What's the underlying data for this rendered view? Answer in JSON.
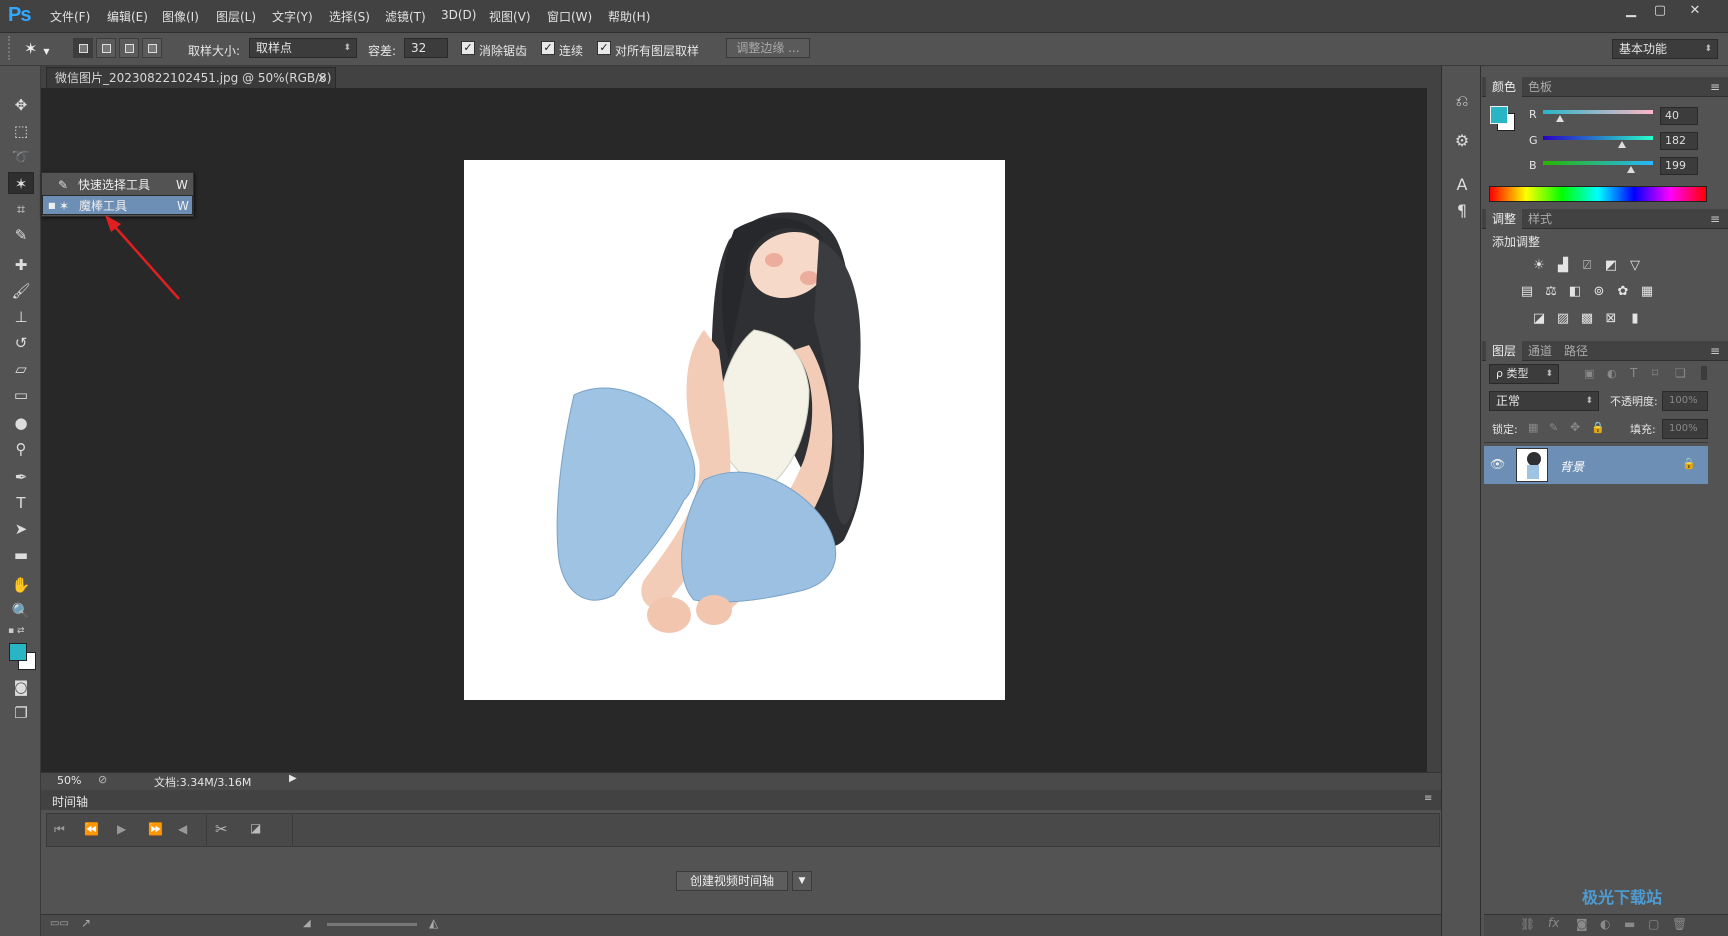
{
  "app": {
    "logo": "Ps",
    "menus": [
      "文件(F)",
      "编辑(E)",
      "图像(I)",
      "图层(L)",
      "文字(Y)",
      "选择(S)",
      "滤镜(T)",
      "3D(D)",
      "视图(V)",
      "窗口(W)",
      "帮助(H)"
    ],
    "window_controls": [
      "▁",
      "▢",
      "✕"
    ]
  },
  "options": {
    "sample_size_label": "取样大小:",
    "sample_size_value": "取样点",
    "tolerance_label": "容差:",
    "tolerance_value": "32",
    "anti_alias_label": "消除锯齿",
    "contiguous_label": "连续",
    "sample_all_label": "对所有图层取样",
    "refine_edge_label": "调整边缘 ...",
    "workspace_value": "基本功能"
  },
  "document": {
    "tab_title": "微信图片_20230822102451.jpg @ 50%(RGB/8)",
    "tab_close": "×",
    "zoom": "50%",
    "doc_info": "文档:3.34M/3.16M"
  },
  "flyout": {
    "items": [
      {
        "label": "快速选择工具",
        "shortcut": "W",
        "selected": false
      },
      {
        "label": "魔棒工具",
        "shortcut": "W",
        "selected": true
      }
    ]
  },
  "timeline": {
    "title": "时间轴",
    "create_button": "创建视频时间轴"
  },
  "color_panel": {
    "tabs": [
      "颜色",
      "色板"
    ],
    "channels": [
      {
        "name": "R",
        "value": "40"
      },
      {
        "name": "G",
        "value": "182"
      },
      {
        "name": "B",
        "value": "199"
      }
    ],
    "foreground_color": "#28b6c7",
    "background_color": "#ffffff"
  },
  "adjust_panel": {
    "tabs": [
      "调整",
      "样式"
    ],
    "heading": "添加调整"
  },
  "layers_panel": {
    "tabs": [
      "图层",
      "通道",
      "路径"
    ],
    "filter_label": "ρ 类型",
    "blend_mode": "正常",
    "opacity_label": "不透明度:",
    "opacity_value": "100%",
    "lock_label": "锁定:",
    "fill_label": "填充:",
    "fill_value": "100%",
    "layers": [
      {
        "name": "背景",
        "visible": true,
        "locked": true
      }
    ]
  },
  "watermark": "极光下载站"
}
